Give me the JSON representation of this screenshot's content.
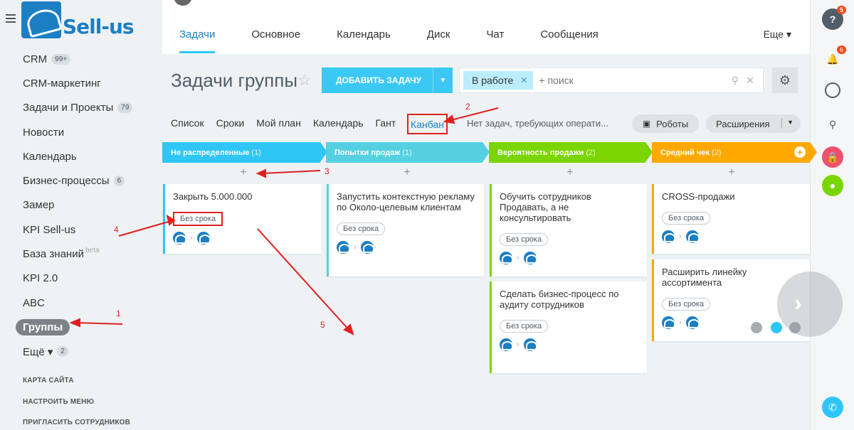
{
  "brand": {
    "name": "Sell-us"
  },
  "sidebar": {
    "items": [
      {
        "label": "CRM",
        "badge": "99+"
      },
      {
        "label": "CRM-маркетинг"
      },
      {
        "label": "Задачи и Проекты",
        "badge": "79"
      },
      {
        "label": "Новости"
      },
      {
        "label": "Календарь"
      },
      {
        "label": "Бизнес-процессы",
        "badge": "6"
      },
      {
        "label": "Замер"
      },
      {
        "label": "KPI Sell-us"
      },
      {
        "label": "База знаний",
        "sup": "beta"
      },
      {
        "label": "KPI 2.0"
      },
      {
        "label": "ABC"
      },
      {
        "label": "Группы",
        "active": true
      },
      {
        "label": "Ещё ▾",
        "badge": "2"
      }
    ],
    "footer": [
      "КАРТА САЙТА",
      "НАСТРОИТЬ МЕНЮ",
      "ПРИГЛАСИТЬ СОТРУДНИКОВ"
    ]
  },
  "tabs": [
    "Задачи",
    "Основное",
    "Календарь",
    "Диск",
    "Чат",
    "Сообщения"
  ],
  "tab_more": "Еще ▾",
  "header": {
    "title": "Задачи группы",
    "add_button": "ДОБАВИТЬ ЗАДАЧУ",
    "filter_chip": "В работе",
    "search_placeholder": "+ поиск"
  },
  "views": {
    "items": [
      "Список",
      "Сроки",
      "Мой план",
      "Календарь",
      "Гант"
    ],
    "active": "Канбан",
    "notice": "Нет задач, требующих операти...",
    "robots": "Роботы",
    "extensions": "Расширения"
  },
  "rail": {
    "help_badge": "5",
    "bell_badge": "6"
  },
  "kanban": {
    "columns": [
      {
        "title": "Не распределенные",
        "count": "(1)",
        "color": "#2fc6f6"
      },
      {
        "title": "Попытки продаж",
        "count": "(1)",
        "color": "#55d0e0"
      },
      {
        "title": "Вероятность продажи",
        "count": "(2)",
        "color": "#7bd500"
      },
      {
        "title": "Средний чек",
        "count": "(2)",
        "color": "#ffa900"
      }
    ],
    "cards": [
      {
        "title": "Закрыть 5.000.000",
        "tag": "Без срока"
      },
      {
        "title": "Запустить контекстную рекламу по Около-целевым клиентам",
        "tag": "Без срока"
      },
      {
        "title": "Обучить сотрудников Продавать, а не консультировать",
        "tag": "Без срока"
      },
      {
        "title": "Сделать бизнес-процесс по аудиту сотрудников",
        "tag": "Без срока"
      },
      {
        "title": "CROSS-продажи",
        "tag": "Без срока"
      },
      {
        "title": "Расширить линейку ассортимента",
        "tag": "Без срока"
      }
    ]
  },
  "annotations": [
    "1",
    "2",
    "3",
    "4",
    "5"
  ]
}
